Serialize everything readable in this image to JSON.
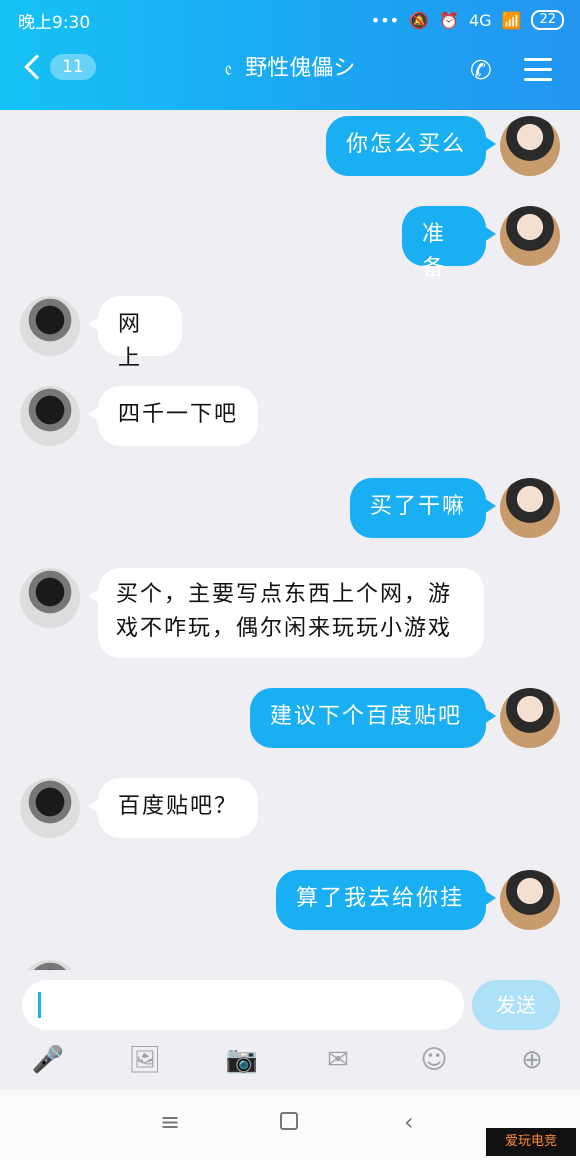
{
  "status": {
    "time": "晚上9:30",
    "signal": "4G",
    "battery": "22"
  },
  "header": {
    "back_count": "11",
    "contact_name": "野性傀儡シ",
    "icons": [
      "back-chevron-icon",
      "ear-icon",
      "phone-icon",
      "menu-icon"
    ]
  },
  "messages": [
    {
      "side": "self",
      "text": "你怎么买么"
    },
    {
      "side": "self",
      "text": "准备"
    },
    {
      "side": "other",
      "text": "网上"
    },
    {
      "side": "other",
      "text": "四千一下吧"
    },
    {
      "side": "self",
      "text": "买了干嘛"
    },
    {
      "side": "other",
      "text": "买个，主要写点东西上个网，游戏不咋玩，偶尔闲来玩玩小游戏"
    },
    {
      "side": "self",
      "text": "建议下个百度贴吧"
    },
    {
      "side": "other",
      "text": "百度贴吧？"
    },
    {
      "side": "self",
      "text": "算了我去给你挂"
    }
  ],
  "composer": {
    "input_value": "",
    "send_label": "发送"
  },
  "toolbar_icons": [
    "microphone-icon",
    "image-icon",
    "camera-icon",
    "red-packet-icon",
    "emoji-icon",
    "plus-icon"
  ],
  "system_nav": [
    "menu-key",
    "home-key",
    "back-key"
  ],
  "watermark": "爱玩电竞",
  "colors": {
    "header_gradient_start": "#16c2f5",
    "header_gradient_end": "#2396f2",
    "self_bubble": "#1aaef3",
    "other_bubble": "#ffffff",
    "chat_bg": "#eeeef3"
  }
}
